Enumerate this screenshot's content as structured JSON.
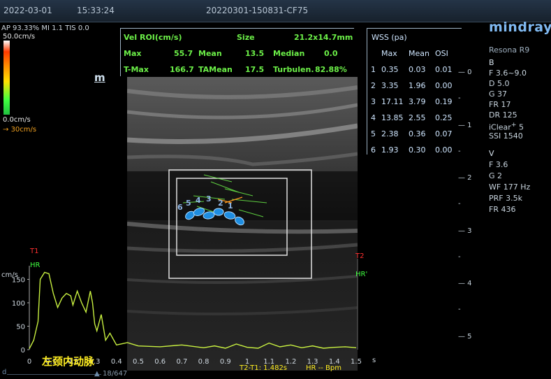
{
  "topbar": {
    "date": "2022-03-01",
    "time": "15:33:24",
    "exam_id": "20220301-150831-CF75"
  },
  "brand": {
    "logo": "mindray",
    "model": "Resona R9"
  },
  "left_info": {
    "ap": "AP 93.33%",
    "mi": "MI 1.1",
    "tis": "TIS 0.0",
    "scale_top": "50.0cm/s",
    "scale_bottom": "0.0cm/s",
    "velocity_arrow": "30cm/s",
    "marker": "m"
  },
  "vel_roi": {
    "title": "Vel ROI(cm/s)",
    "size_label": "Size",
    "size_value": "21.2x14.7mm",
    "max_label": "Max",
    "max_value": "55.7",
    "mean_label": "Mean",
    "mean_value": "13.5",
    "median_label": "Median",
    "median_value": "0.0",
    "tmax_label": "T-Max",
    "tmax_value": "166.7",
    "tamean_label": "TAMean",
    "tamean_value": "17.5",
    "turb_label": "Turbulen.",
    "turb_value": "82.88%"
  },
  "wss": {
    "title": "WSS (pa)",
    "headers": [
      "Max",
      "Mean",
      "OSI"
    ],
    "rows": [
      [
        "1",
        "0.35",
        "0.03",
        "0.01"
      ],
      [
        "2",
        "3.35",
        "1.96",
        "0.00"
      ],
      [
        "3",
        "17.11",
        "3.79",
        "0.19"
      ],
      [
        "4",
        "13.85",
        "2.55",
        "0.25"
      ],
      [
        "5",
        "2.38",
        "0.36",
        "0.07"
      ],
      [
        "6",
        "1.93",
        "0.30",
        "0.00"
      ]
    ]
  },
  "params_b": {
    "mode": "B",
    "f": "F 3.6~9.0",
    "d": "D 5.0",
    "g": "G 37",
    "fr": "FR 17",
    "dr": "DR 125",
    "iclear_label": "iClear",
    "iclear_sup": "+",
    "iclear_value": "5",
    "ssi": "SSI 1540"
  },
  "params_v": {
    "mode": "V",
    "f": "F 3.6",
    "g": "G 2",
    "wf": "WF 177 Hz",
    "prf": "PRF 3.5k",
    "fr": "FR 436"
  },
  "depth_scale": [
    "0",
    "1",
    "2",
    "3",
    "4",
    "5"
  ],
  "wss_points": [
    "6",
    "5",
    "4",
    "3",
    "2",
    "1"
  ],
  "graph": {
    "unit": "cm/s",
    "t1": "T1",
    "t2": "T2",
    "hr": "HR",
    "hr2": "HR'",
    "y_ticks": [
      "150",
      "100",
      "50",
      "0"
    ],
    "x_ticks": [
      "0",
      "0.1",
      "0.2",
      "0.3",
      "0.4",
      "0.5",
      "0.6",
      "0.7",
      "0.8",
      "0.9",
      "1",
      "1.1",
      "1.2",
      "1.3",
      "1.4",
      "1.5"
    ],
    "x_unit": "s",
    "vessel_label": "左颈内动脉",
    "interval": "T2-T1: 1.482s",
    "hr_value": "HR -- Bpm",
    "frame": "18/647",
    "frame_prefix": "d",
    "trace": [
      [
        0,
        2
      ],
      [
        0.02,
        20
      ],
      [
        0.04,
        60
      ],
      [
        0.05,
        150
      ],
      [
        0.07,
        165
      ],
      [
        0.09,
        162
      ],
      [
        0.11,
        120
      ],
      [
        0.13,
        90
      ],
      [
        0.15,
        110
      ],
      [
        0.17,
        120
      ],
      [
        0.19,
        115
      ],
      [
        0.2,
        95
      ],
      [
        0.22,
        125
      ],
      [
        0.24,
        100
      ],
      [
        0.26,
        80
      ],
      [
        0.28,
        125
      ],
      [
        0.29,
        100
      ],
      [
        0.3,
        55
      ],
      [
        0.31,
        40
      ],
      [
        0.33,
        75
      ],
      [
        0.35,
        20
      ],
      [
        0.37,
        35
      ],
      [
        0.4,
        10
      ],
      [
        0.45,
        15
      ],
      [
        0.5,
        8
      ],
      [
        0.6,
        6
      ],
      [
        0.7,
        10
      ],
      [
        0.8,
        4
      ],
      [
        0.85,
        8
      ],
      [
        0.9,
        3
      ],
      [
        0.95,
        12
      ],
      [
        1.0,
        5
      ],
      [
        1.05,
        3
      ],
      [
        1.1,
        14
      ],
      [
        1.15,
        6
      ],
      [
        1.2,
        10
      ],
      [
        1.25,
        4
      ],
      [
        1.3,
        8
      ],
      [
        1.35,
        3
      ],
      [
        1.4,
        5
      ],
      [
        1.45,
        6
      ],
      [
        1.5,
        4
      ]
    ]
  }
}
